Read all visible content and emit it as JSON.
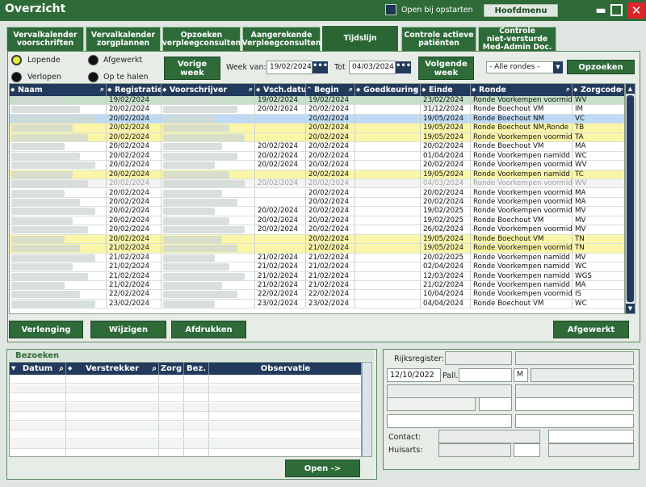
{
  "window": {
    "title": "Overzicht",
    "startup_checkbox_label": "Open bij opstarten",
    "main_menu_label": "Hoofdmenu"
  },
  "tabs": [
    {
      "label": "Vervalkalender\nvoorschriften"
    },
    {
      "label": "Vervalkalender\nzorgplannen"
    },
    {
      "label": "Opzoeken\nverpleegconsulten"
    },
    {
      "label": "Aangerekende\nVerpleegconsulten"
    },
    {
      "label": "Tijdslijn"
    },
    {
      "label": "Controle actieve\npatiënten"
    },
    {
      "label": "Controle\nniet-versturde\nMed-Admin Doc."
    }
  ],
  "filters": {
    "status_options": [
      "Lopende",
      "Afgewerkt",
      "Verlopen",
      "Op te halen"
    ],
    "selected_status": "Lopende",
    "prev_week_label": "Vorige\nweek",
    "next_week_label": "Volgende\nweek",
    "week_from_label": "Week van:",
    "week_from_value": "19/02/2024",
    "week_to_label": "Tot",
    "week_to_value": "04/03/2024",
    "round_select_value": "- Alle rondes -",
    "search_label": "Opzoeken",
    "dots": "•••"
  },
  "grid": {
    "columns": [
      "Naam",
      "Registratie",
      "Voorschrijver",
      "Vsch.datum",
      "Begin",
      "Goedkeuring",
      "Einde",
      "Ronde",
      "Zorgcode"
    ],
    "rows": [
      {
        "reg": "19/02/2024",
        "vsch": "19/02/2024",
        "begin": "19/02/2024",
        "einde": "23/02/2024",
        "ronde": "Ronde Voorkempen voormid",
        "code": "WV",
        "hl": "sel"
      },
      {
        "reg": "20/02/2024",
        "vsch": "20/02/2024",
        "begin": "20/02/2024",
        "einde": "31/12/2024",
        "ronde": "Ronde Boechout VM",
        "code": "IM",
        "hl": ""
      },
      {
        "reg": "20/02/2024",
        "vsch": "",
        "begin": "20/02/2024",
        "einde": "19/05/2024",
        "ronde": "Ronde Boechout NM",
        "code": "VC",
        "hl": "blue"
      },
      {
        "reg": "20/02/2024",
        "vsch": "",
        "begin": "20/02/2024",
        "einde": "19/05/2024",
        "ronde": "Ronde Boechout NM,Ronde",
        "code": "TB",
        "hl": "yellow"
      },
      {
        "reg": "20/02/2024",
        "vsch": "",
        "begin": "20/02/2024",
        "einde": "19/05/2024",
        "ronde": "Ronde Voorkempen voormid",
        "code": "TA",
        "hl": "yellow"
      },
      {
        "reg": "20/02/2024",
        "vsch": "20/02/2024",
        "begin": "20/02/2024",
        "einde": "20/02/2024",
        "ronde": "Ronde Boechout VM",
        "code": "MA",
        "hl": ""
      },
      {
        "reg": "20/02/2024",
        "vsch": "20/02/2024",
        "begin": "20/02/2024",
        "einde": "01/04/2024",
        "ronde": "Ronde Voorkempen namidd",
        "code": "WC",
        "hl": ""
      },
      {
        "reg": "20/02/2024",
        "vsch": "20/02/2024",
        "begin": "20/02/2024",
        "einde": "20/02/2024",
        "ronde": "Ronde Voorkempen voormid",
        "code": "WV",
        "hl": ""
      },
      {
        "reg": "20/02/2024",
        "vsch": "",
        "begin": "20/02/2024",
        "einde": "19/05/2024",
        "ronde": "Ronde Voorkempen namidd",
        "code": "TC",
        "hl": "yellow"
      },
      {
        "reg": "20/02/2024",
        "vsch": "20/02/2024",
        "begin": "20/02/2024",
        "einde": "04/03/2024",
        "ronde": "Ronde Voorkempen voormid",
        "code": "WV",
        "hl": "grey"
      },
      {
        "reg": "20/02/2024",
        "vsch": "",
        "begin": "20/02/2024",
        "einde": "20/02/2024",
        "ronde": "Ronde Voorkempen voormid",
        "code": "MA",
        "hl": ""
      },
      {
        "reg": "20/02/2024",
        "vsch": "",
        "begin": "20/02/2024",
        "einde": "20/02/2024",
        "ronde": "Ronde Voorkempen voormid",
        "code": "MA",
        "hl": ""
      },
      {
        "reg": "20/02/2024",
        "vsch": "20/02/2024",
        "begin": "20/02/2024",
        "einde": "19/02/2025",
        "ronde": "Ronde Voorkempen voormid",
        "code": "MV",
        "hl": ""
      },
      {
        "reg": "20/02/2024",
        "vsch": "20/02/2024",
        "begin": "20/02/2024",
        "einde": "19/02/2025",
        "ronde": "Ronde Boechout VM",
        "code": "MV",
        "hl": ""
      },
      {
        "reg": "20/02/2024",
        "vsch": "20/02/2024",
        "begin": "20/02/2024",
        "einde": "26/02/2024",
        "ronde": "Ronde Voorkempen voormid",
        "code": "MV",
        "hl": ""
      },
      {
        "reg": "20/02/2024",
        "vsch": "",
        "begin": "20/02/2024",
        "einde": "19/05/2024",
        "ronde": "Ronde Boechout VM",
        "code": "TN",
        "hl": "yellow"
      },
      {
        "reg": "21/02/2024",
        "vsch": "",
        "begin": "21/02/2024",
        "einde": "19/05/2024",
        "ronde": "Ronde Voorkempen voormid",
        "code": "TN",
        "hl": "yellow"
      },
      {
        "reg": "21/02/2024",
        "vsch": "21/02/2024",
        "begin": "21/02/2024",
        "einde": "20/02/2025",
        "ronde": "Ronde Voorkempen namidd",
        "code": "MV",
        "hl": ""
      },
      {
        "reg": "21/02/2024",
        "vsch": "21/02/2024",
        "begin": "21/02/2024",
        "einde": "02/04/2024",
        "ronde": "Ronde Voorkempen namidd",
        "code": "WC",
        "hl": ""
      },
      {
        "reg": "21/02/2024",
        "vsch": "21/02/2024",
        "begin": "21/02/2024",
        "einde": "12/03/2024",
        "ronde": "Ronde Voorkempen namidd",
        "code": "WGS",
        "hl": ""
      },
      {
        "reg": "21/02/2024",
        "vsch": "21/02/2024",
        "begin": "21/02/2024",
        "einde": "21/02/2024",
        "ronde": "Ronde Voorkempen namidd",
        "code": "MA",
        "hl": ""
      },
      {
        "reg": "22/02/2024",
        "vsch": "22/02/2024",
        "begin": "22/02/2024",
        "einde": "10/04/2024",
        "ronde": "Ronde Voorkempen voormid",
        "code": "IS",
        "hl": ""
      },
      {
        "reg": "23/02/2024",
        "vsch": "23/02/2024",
        "begin": "23/02/2024",
        "einde": "04/04/2024",
        "ronde": "Ronde Boechout VM",
        "code": "WC",
        "hl": ""
      }
    ]
  },
  "actions": {
    "extend_label": "Verlenging",
    "edit_label": "Wijzigen",
    "print_label": "Afdrukken",
    "done_label": "Afgewerkt"
  },
  "visits": {
    "title": "Bezoeken",
    "columns": [
      "Datum",
      "Verstrekker",
      "Zorg",
      "Bez.",
      "Observatie"
    ],
    "open_label": "Open ->"
  },
  "patient": {
    "rijksregister_label": "Rijksregister:",
    "birth_date": "12/10/2022",
    "pall_label": "Pall.",
    "gender": "M",
    "contact_label": "Contact:",
    "huisarts_label": "Huisarts:"
  },
  "colors": {
    "accent": "#2e6b38",
    "header": "#223a5c",
    "highlight_yellow": "#fbf6a7",
    "highlight_blue": "#bfdaf5",
    "selected": "#c7e0c9"
  }
}
